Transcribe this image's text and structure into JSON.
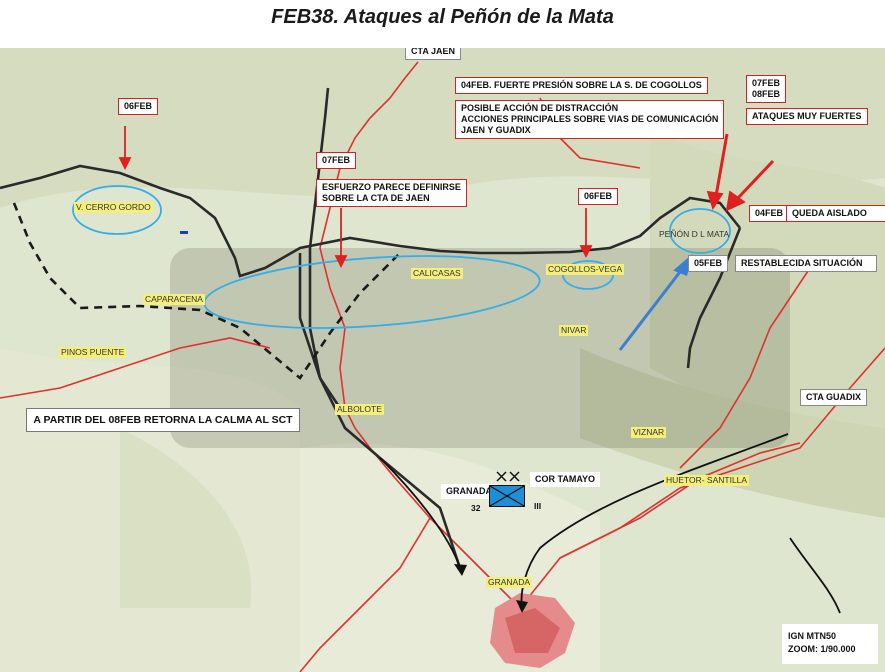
{
  "title": "FEB38. Ataques al Peñón de la Mata",
  "map": {
    "annotations": {
      "cta_jaen": "CTA JAEN",
      "feb06_west": "06FEB",
      "feb07": "07FEB",
      "esfuerzo": "ESFUERZO PARECE DEFINIRSE\nSOBRE LA CTA DE JAEN",
      "feb04_presion": "04FEB. FUERTE PRESIÓN SOBRE LA S. DE COGOLLOS",
      "posible": "POSIBLE ACCIÓN DE DISTRACCIÓN\nACCIONES PRINCIPALES SOBRE VIAS DE COMUNICACIÓN\nJAEN Y GUADIX",
      "feb07_08": "07FEB\n08FEB",
      "ataques": "ATAQUES MUY FUERTES",
      "feb06_center": "06FEB",
      "feb04_aislado_date": "04FEB",
      "quedo_aislado": "QUEDA AISLADO",
      "feb05": "05FEB",
      "restablecida": "RESTABLECIDA SITUACIÓN",
      "cta_guadix": "CTA GUADIX",
      "cor_tamayo": "COR TAMAYO",
      "granada_unit": "GRANADA",
      "unit_32": "32",
      "unit_iii": "III"
    },
    "places": {
      "cerro_gordo": "V. CERRO GORDO",
      "calicasas": "CALICASAS",
      "cogollos": "COGOLLOS-VEGA",
      "penon": "PEÑÓN D L MATA",
      "caparacena": "CAPARACENA",
      "pinos_puente": "PINOS PUENTE",
      "nivar": "NIVAR",
      "albolote": "ALBOLOTE",
      "viznar": "VIZNAR",
      "huetor": "HUETOR- SANTILLA",
      "granada_city": "GRANADA"
    },
    "calm_note": "A PARTIR DEL 08FEB RETORNA LA CALMA AL SCT",
    "scale": {
      "source": "IGN MTN50",
      "zoom": "ZOOM: 1/90.000"
    },
    "colors": {
      "front_line": "#2a2a2a",
      "road": "#e03030",
      "attack_arrow": "#e02020",
      "counter_arrow": "#3a7fd0",
      "highlight_ellipse": "#35aee8",
      "unit_box": "#1e8fd6",
      "place_label_bg": "#f4ef7a"
    }
  }
}
